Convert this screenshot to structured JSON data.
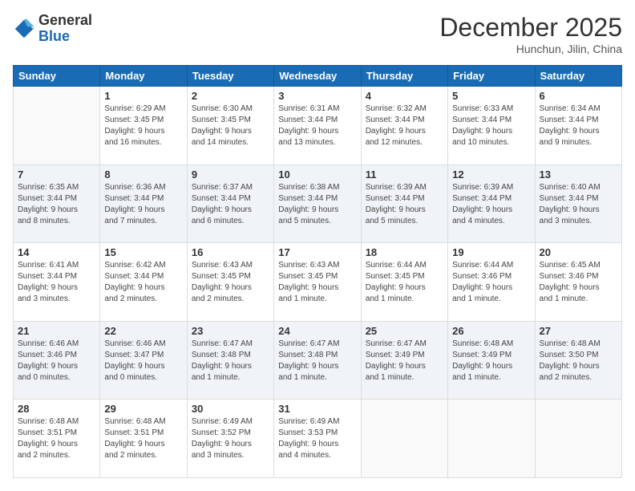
{
  "logo": {
    "general": "General",
    "blue": "Blue"
  },
  "header": {
    "month": "December 2025",
    "location": "Hunchun, Jilin, China"
  },
  "weekdays": [
    "Sunday",
    "Monday",
    "Tuesday",
    "Wednesday",
    "Thursday",
    "Friday",
    "Saturday"
  ],
  "weeks": [
    [
      {
        "day": "",
        "info": ""
      },
      {
        "day": "1",
        "info": "Sunrise: 6:29 AM\nSunset: 3:45 PM\nDaylight: 9 hours\nand 16 minutes."
      },
      {
        "day": "2",
        "info": "Sunrise: 6:30 AM\nSunset: 3:45 PM\nDaylight: 9 hours\nand 14 minutes."
      },
      {
        "day": "3",
        "info": "Sunrise: 6:31 AM\nSunset: 3:44 PM\nDaylight: 9 hours\nand 13 minutes."
      },
      {
        "day": "4",
        "info": "Sunrise: 6:32 AM\nSunset: 3:44 PM\nDaylight: 9 hours\nand 12 minutes."
      },
      {
        "day": "5",
        "info": "Sunrise: 6:33 AM\nSunset: 3:44 PM\nDaylight: 9 hours\nand 10 minutes."
      },
      {
        "day": "6",
        "info": "Sunrise: 6:34 AM\nSunset: 3:44 PM\nDaylight: 9 hours\nand 9 minutes."
      }
    ],
    [
      {
        "day": "7",
        "info": "Sunrise: 6:35 AM\nSunset: 3:44 PM\nDaylight: 9 hours\nand 8 minutes."
      },
      {
        "day": "8",
        "info": "Sunrise: 6:36 AM\nSunset: 3:44 PM\nDaylight: 9 hours\nand 7 minutes."
      },
      {
        "day": "9",
        "info": "Sunrise: 6:37 AM\nSunset: 3:44 PM\nDaylight: 9 hours\nand 6 minutes."
      },
      {
        "day": "10",
        "info": "Sunrise: 6:38 AM\nSunset: 3:44 PM\nDaylight: 9 hours\nand 5 minutes."
      },
      {
        "day": "11",
        "info": "Sunrise: 6:39 AM\nSunset: 3:44 PM\nDaylight: 9 hours\nand 5 minutes."
      },
      {
        "day": "12",
        "info": "Sunrise: 6:39 AM\nSunset: 3:44 PM\nDaylight: 9 hours\nand 4 minutes."
      },
      {
        "day": "13",
        "info": "Sunrise: 6:40 AM\nSunset: 3:44 PM\nDaylight: 9 hours\nand 3 minutes."
      }
    ],
    [
      {
        "day": "14",
        "info": "Sunrise: 6:41 AM\nSunset: 3:44 PM\nDaylight: 9 hours\nand 3 minutes."
      },
      {
        "day": "15",
        "info": "Sunrise: 6:42 AM\nSunset: 3:44 PM\nDaylight: 9 hours\nand 2 minutes."
      },
      {
        "day": "16",
        "info": "Sunrise: 6:43 AM\nSunset: 3:45 PM\nDaylight: 9 hours\nand 2 minutes."
      },
      {
        "day": "17",
        "info": "Sunrise: 6:43 AM\nSunset: 3:45 PM\nDaylight: 9 hours\nand 1 minute."
      },
      {
        "day": "18",
        "info": "Sunrise: 6:44 AM\nSunset: 3:45 PM\nDaylight: 9 hours\nand 1 minute."
      },
      {
        "day": "19",
        "info": "Sunrise: 6:44 AM\nSunset: 3:46 PM\nDaylight: 9 hours\nand 1 minute."
      },
      {
        "day": "20",
        "info": "Sunrise: 6:45 AM\nSunset: 3:46 PM\nDaylight: 9 hours\nand 1 minute."
      }
    ],
    [
      {
        "day": "21",
        "info": "Sunrise: 6:46 AM\nSunset: 3:46 PM\nDaylight: 9 hours\nand 0 minutes."
      },
      {
        "day": "22",
        "info": "Sunrise: 6:46 AM\nSunset: 3:47 PM\nDaylight: 9 hours\nand 0 minutes."
      },
      {
        "day": "23",
        "info": "Sunrise: 6:47 AM\nSunset: 3:48 PM\nDaylight: 9 hours\nand 1 minute."
      },
      {
        "day": "24",
        "info": "Sunrise: 6:47 AM\nSunset: 3:48 PM\nDaylight: 9 hours\nand 1 minute."
      },
      {
        "day": "25",
        "info": "Sunrise: 6:47 AM\nSunset: 3:49 PM\nDaylight: 9 hours\nand 1 minute."
      },
      {
        "day": "26",
        "info": "Sunrise: 6:48 AM\nSunset: 3:49 PM\nDaylight: 9 hours\nand 1 minute."
      },
      {
        "day": "27",
        "info": "Sunrise: 6:48 AM\nSunset: 3:50 PM\nDaylight: 9 hours\nand 2 minutes."
      }
    ],
    [
      {
        "day": "28",
        "info": "Sunrise: 6:48 AM\nSunset: 3:51 PM\nDaylight: 9 hours\nand 2 minutes."
      },
      {
        "day": "29",
        "info": "Sunrise: 6:48 AM\nSunset: 3:51 PM\nDaylight: 9 hours\nand 2 minutes."
      },
      {
        "day": "30",
        "info": "Sunrise: 6:49 AM\nSunset: 3:52 PM\nDaylight: 9 hours\nand 3 minutes."
      },
      {
        "day": "31",
        "info": "Sunrise: 6:49 AM\nSunset: 3:53 PM\nDaylight: 9 hours\nand 4 minutes."
      },
      {
        "day": "",
        "info": ""
      },
      {
        "day": "",
        "info": ""
      },
      {
        "day": "",
        "info": ""
      }
    ]
  ]
}
